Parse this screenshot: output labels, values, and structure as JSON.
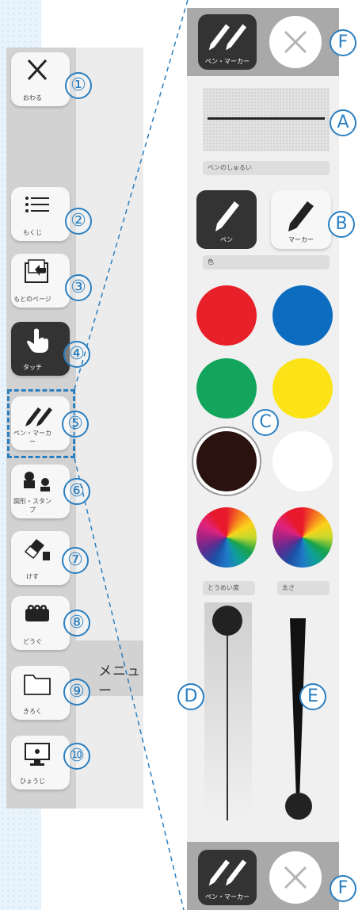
{
  "left_toolbar": {
    "buttons": [
      {
        "label": "おわる",
        "num": "①"
      },
      {
        "label": "もくじ",
        "num": "②"
      },
      {
        "label": "もとのページ",
        "num": "③"
      },
      {
        "label": "タッチ",
        "num": "④"
      },
      {
        "label": "ペン・マーカー",
        "num": "⑤"
      },
      {
        "label": "図形・スタンプ",
        "num": "⑥"
      },
      {
        "label": "けす",
        "num": "⑦"
      },
      {
        "label": "どうぐ",
        "num": "⑧"
      },
      {
        "label": "きろく",
        "num": "⑨"
      },
      {
        "label": "ひょうじ",
        "num": "⑩"
      }
    ],
    "menu_tab_label": "メニュー"
  },
  "pen_panel": {
    "pen_marker_label": "ペン・マーカー",
    "marker_F": "F",
    "marker_A": "A",
    "marker_B": "B",
    "marker_C": "C",
    "marker_D": "D",
    "marker_E": "E",
    "type_section_label": "ペンのしゅるい",
    "pen_label": "ペン",
    "marker_label": "マーカー",
    "color_section_label": "色",
    "colors": [
      "#e8202a",
      "#0c6cbf",
      "#13a55c",
      "#fbe317",
      "#2a120e",
      "#ffffff"
    ],
    "opacity_label": "とうめい度",
    "size_label": "太さ",
    "opacity_value": 0.0,
    "size_value": 0.85
  }
}
